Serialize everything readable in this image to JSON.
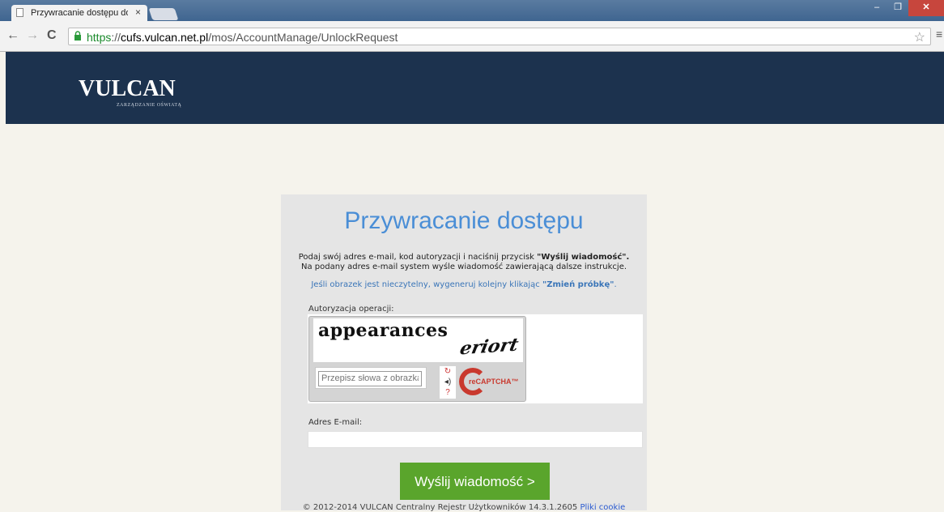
{
  "browser": {
    "tab_title": "Przywracanie dostępu do",
    "tab_close": "×",
    "url_scheme": "https",
    "url_sep": "://",
    "url_host": "cufs.vulcan.net.pl",
    "url_path": "/mos/AccountManage/UnlockRequest",
    "back": "←",
    "forward": "→",
    "reload": "C",
    "star": "☆",
    "menu": "≡",
    "min": "–",
    "max": "❐",
    "close": "✕"
  },
  "header": {
    "logo": "VULCAN",
    "logo_sub": "ZARZĄDZANIE OŚWIATĄ"
  },
  "form": {
    "title": "Przywracanie dostępu",
    "desc_line1_pre": "Podaj swój adres e-mail, kod autoryzacji i naciśnij przycisk ",
    "desc_line1_bold": "\"Wyślij wiadomość\".",
    "desc_line2": "Na podany adres e-mail system wyśle wiadomość zawierającą dalsze instrukcje.",
    "hint_pre": "Jeśli obrazek jest nieczytelny, wygeneruj kolejny klikając ",
    "hint_bold": "\"Zmień próbkę\"",
    "hint_post": ".",
    "auth_label": "Autoryzacja operacji:",
    "captcha_word1": "appearances",
    "captcha_word2": "eriort",
    "captcha_placeholder": "Przepisz słowa z obrazka",
    "recaptcha_brand": "reCAPTCHA™",
    "email_label": "Adres E-mail:",
    "email_value": "",
    "submit": "Wyślij wiadomość >"
  },
  "footer": {
    "text": "© 2012-2014 VULCAN Centralny Rejestr Użytkowników 14.3.1.2605 ",
    "link": "Pliki cookie"
  },
  "colors": {
    "header_bg": "#1c324e",
    "title": "#4a8ed6",
    "submit_bg": "#5aa52c"
  }
}
